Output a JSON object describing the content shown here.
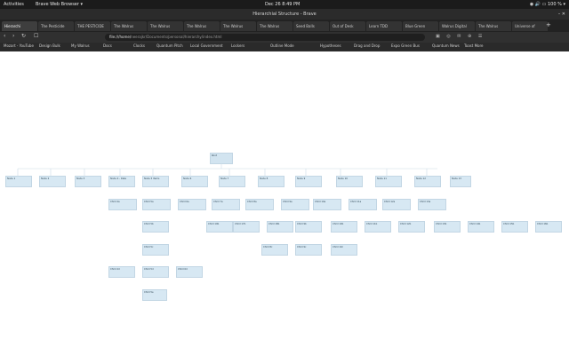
{
  "system": {
    "activities": "Activities",
    "app_name": "Brave Web Browser ▾",
    "clock": "Dec 26  8:49 PM",
    "battery": "100 %"
  },
  "window": {
    "title": "Hierarchial Structure - Brave"
  },
  "tabs": [
    {
      "label": "Hierarchi"
    },
    {
      "label": "The Pesticide"
    },
    {
      "label": "THE PESTICIDE"
    },
    {
      "label": "The Walrus"
    },
    {
      "label": "The Walrus"
    },
    {
      "label": "The Walrus"
    },
    {
      "label": "The Walrus"
    },
    {
      "label": "The Walrus"
    },
    {
      "label": "Seed Balls"
    },
    {
      "label": "Out of Desk"
    },
    {
      "label": "Learn TDD"
    },
    {
      "label": "Blue Green"
    },
    {
      "label": "Walrus Digital"
    },
    {
      "label": "The Walrus"
    },
    {
      "label": "Universe of"
    }
  ],
  "address_bar": {
    "host": "file:///home/",
    "path": "neerajkr/Documents/personal/hierarchy/index.html"
  },
  "bookmarks": [
    {
      "label": "Mozart - YouTube"
    },
    {
      "label": "Design Bulk"
    },
    {
      "label": "My Walrus"
    },
    {
      "label": "Docs"
    },
    {
      "label": "Clocks"
    },
    {
      "label": "Quantum Pitch"
    },
    {
      "label": "Local Government"
    },
    {
      "label": "Lockers"
    },
    {
      "label": "Outline Mode"
    },
    {
      "label": "Hypotheses"
    },
    {
      "label": "Drag and Drop"
    },
    {
      "label": "Expo Green Bus"
    },
    {
      "label": "Quantum News"
    },
    {
      "label": "Toast More"
    }
  ],
  "tree": {
    "root": "Root",
    "level1": [
      "Node 1",
      "Node 2",
      "Node 3",
      "Node 4 - Data",
      "Node 5 Items",
      "Node 6",
      "Node 7",
      "Node 8",
      "Node 9",
      "Node 10",
      "Node 11",
      "Node 12",
      "Node 13"
    ],
    "level2": [
      "Child 4a",
      "Child 5a",
      "Child 6a",
      "Child 7a",
      "Child 8a",
      "Child 9a",
      "Child 10a",
      "Child 11a",
      "Child 12a",
      "Child 13a"
    ],
    "level3": [
      "Child 5b",
      "Child 9b",
      "Child 10b",
      "Child 11b",
      "Child 12b",
      "Child 13b",
      "Child 14b",
      "Child 15b",
      "Child 16b",
      "Child 17b",
      "Child 18b",
      "Child 19b"
    ],
    "level4": [
      "Child 5c",
      "Child 8c",
      "Child 9c",
      "Child 10c"
    ],
    "level5": [
      "Child 4d",
      "Child 5d",
      "Child 6d"
    ],
    "level6": [
      "Child 5e"
    ]
  }
}
